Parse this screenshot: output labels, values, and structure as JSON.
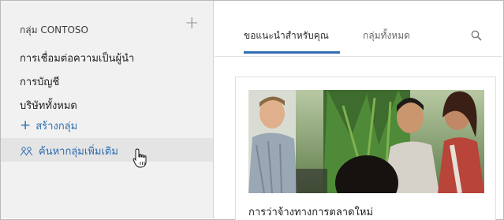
{
  "sidebar": {
    "header": "กลุ่ม CONTOSO",
    "items": [
      {
        "label": "การเชื่อมต่อความเป็นผู้นำ"
      },
      {
        "label": "การบัญชี"
      },
      {
        "label": "บริษัททั้งหมด"
      }
    ],
    "create_label": "สร้างกลุ่ม",
    "discover_label": "ค้นหากลุ่มเพิ่มเติม"
  },
  "tabs": [
    {
      "label": "ขอแนะนำสำหรับคุณ",
      "active": true
    },
    {
      "label": "กลุ่มทั้งหมด",
      "active": false
    }
  ],
  "card": {
    "title": "การว่าจ้างทางการตลาดใหม่"
  },
  "colors": {
    "accent": "#2f6db5",
    "link": "#2b6cb0",
    "sidebar_bg": "#f1f1f1"
  }
}
